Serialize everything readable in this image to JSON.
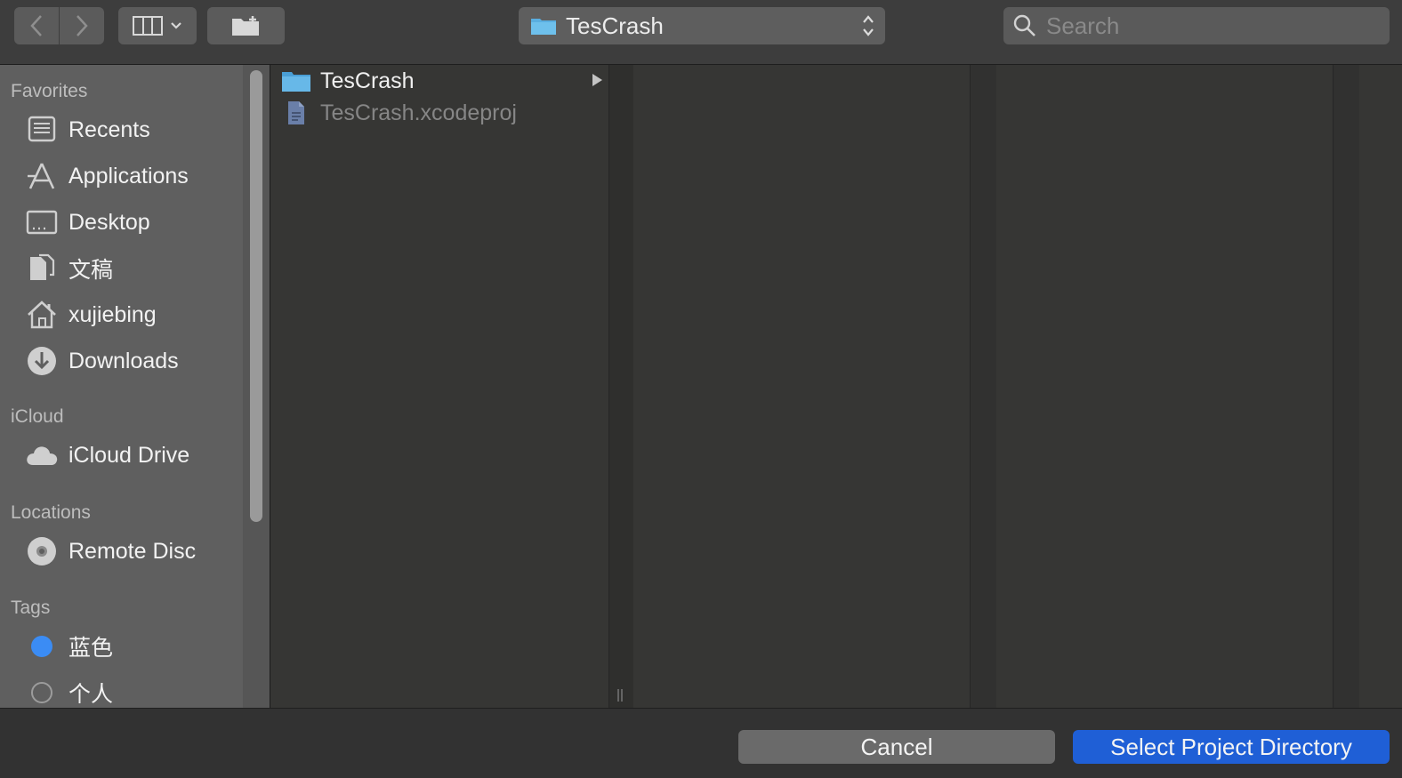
{
  "toolbar": {
    "location": "TesCrash",
    "search_placeholder": "Search"
  },
  "sidebar": {
    "favorites_header": "Favorites",
    "favorites": [
      {
        "label": "Recents",
        "icon": "recents-icon"
      },
      {
        "label": "Applications",
        "icon": "applications-icon"
      },
      {
        "label": "Desktop",
        "icon": "desktop-icon"
      },
      {
        "label": "文稿",
        "icon": "documents-icon"
      },
      {
        "label": "xujiebing",
        "icon": "home-icon"
      },
      {
        "label": "Downloads",
        "icon": "downloads-icon"
      }
    ],
    "icloud_header": "iCloud",
    "icloud": [
      {
        "label": "iCloud Drive",
        "icon": "cloud-icon"
      }
    ],
    "locations_header": "Locations",
    "locations": [
      {
        "label": "Remote Disc",
        "icon": "disc-icon"
      }
    ],
    "tags_header": "Tags",
    "tags": [
      {
        "label": "蓝色",
        "color": "#3b8cf4"
      },
      {
        "label": "个人",
        "color": ""
      }
    ]
  },
  "browser": {
    "column1": [
      {
        "name": "TesCrash",
        "kind": "folder",
        "dimmed": false
      },
      {
        "name": "TesCrash.xcodeproj",
        "kind": "file",
        "dimmed": true
      }
    ]
  },
  "footer": {
    "cancel_label": "Cancel",
    "confirm_label": "Select Project Directory"
  },
  "colors": {
    "accent": "#1f5fd6",
    "folder": "#5aaee0",
    "tag_blue": "#3b8cf4"
  }
}
